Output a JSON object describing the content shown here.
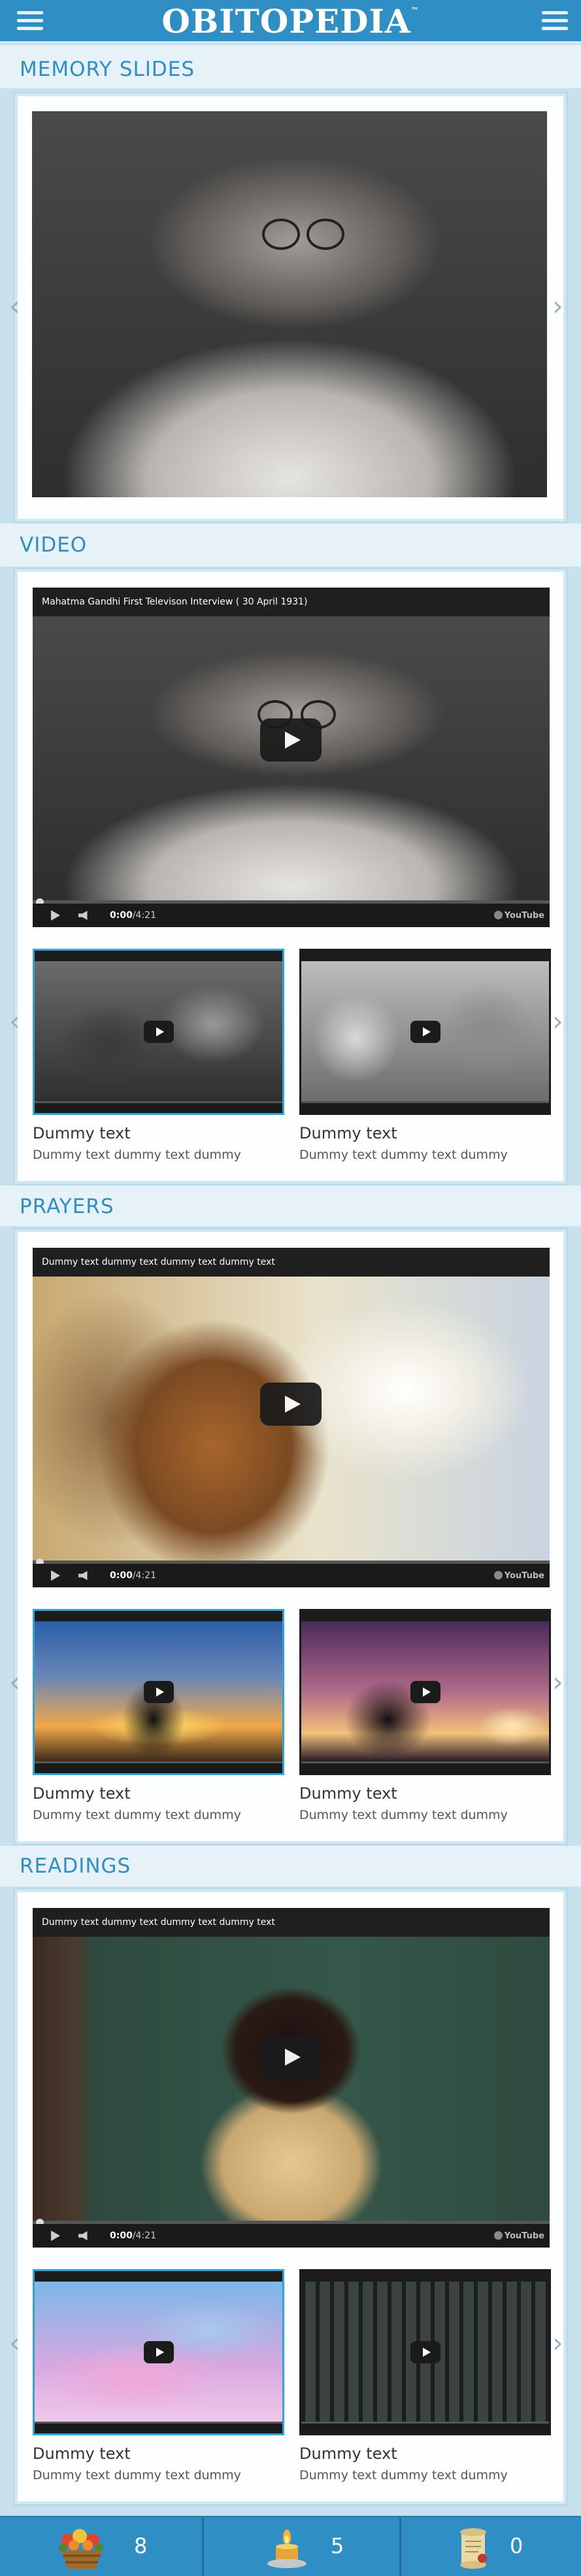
{
  "header": {
    "logo": "OBITOPEDIA",
    "trademark": "™",
    "left_menu_icon": "hamburger-icon",
    "right_menu_icon": "hamburger-icon"
  },
  "sections": {
    "memory_slides": {
      "title": "MEMORY SLIDES"
    },
    "video": {
      "title": "VIDEO",
      "player": {
        "title": "Mahatma Gandhi First Televison Interview ( 30 April 1931)",
        "time_current": "0:00",
        "time_total": "/4:21",
        "brand": "YouTube"
      },
      "thumbs": [
        {
          "title": "Dummy text",
          "subtitle": "Dummy text dummy text dummy"
        },
        {
          "title": "Dummy text",
          "subtitle": "Dummy text dummy text dummy"
        }
      ]
    },
    "prayers": {
      "title": "PRAYERS",
      "player": {
        "title": "Dummy text dummy text dummy text dummy text",
        "time_current": "0:00",
        "time_total": "/4:21",
        "brand": "YouTube"
      },
      "thumbs": [
        {
          "title": "Dummy text",
          "subtitle": "Dummy text dummy text dummy"
        },
        {
          "title": "Dummy text",
          "subtitle": "Dummy text dummy text dummy"
        }
      ]
    },
    "readings": {
      "title": "READINGS",
      "player": {
        "title": "Dummy text dummy text dummy text dummy text",
        "time_current": "0:00",
        "time_total": "/4:21",
        "brand": "YouTube"
      },
      "thumbs": [
        {
          "title": "Dummy text",
          "subtitle": "Dummy text dummy text dummy"
        },
        {
          "title": "Dummy text",
          "subtitle": "Dummy text dummy text dummy"
        }
      ]
    }
  },
  "footer": {
    "items": [
      {
        "icon": "flower-basket-icon",
        "count": "8"
      },
      {
        "icon": "candle-icon",
        "count": "5"
      },
      {
        "icon": "scroll-icon",
        "count": "0"
      }
    ]
  },
  "colors": {
    "header": "#2f8fc4",
    "accent": "#2f8fc4",
    "background": "#c9e1ec"
  }
}
